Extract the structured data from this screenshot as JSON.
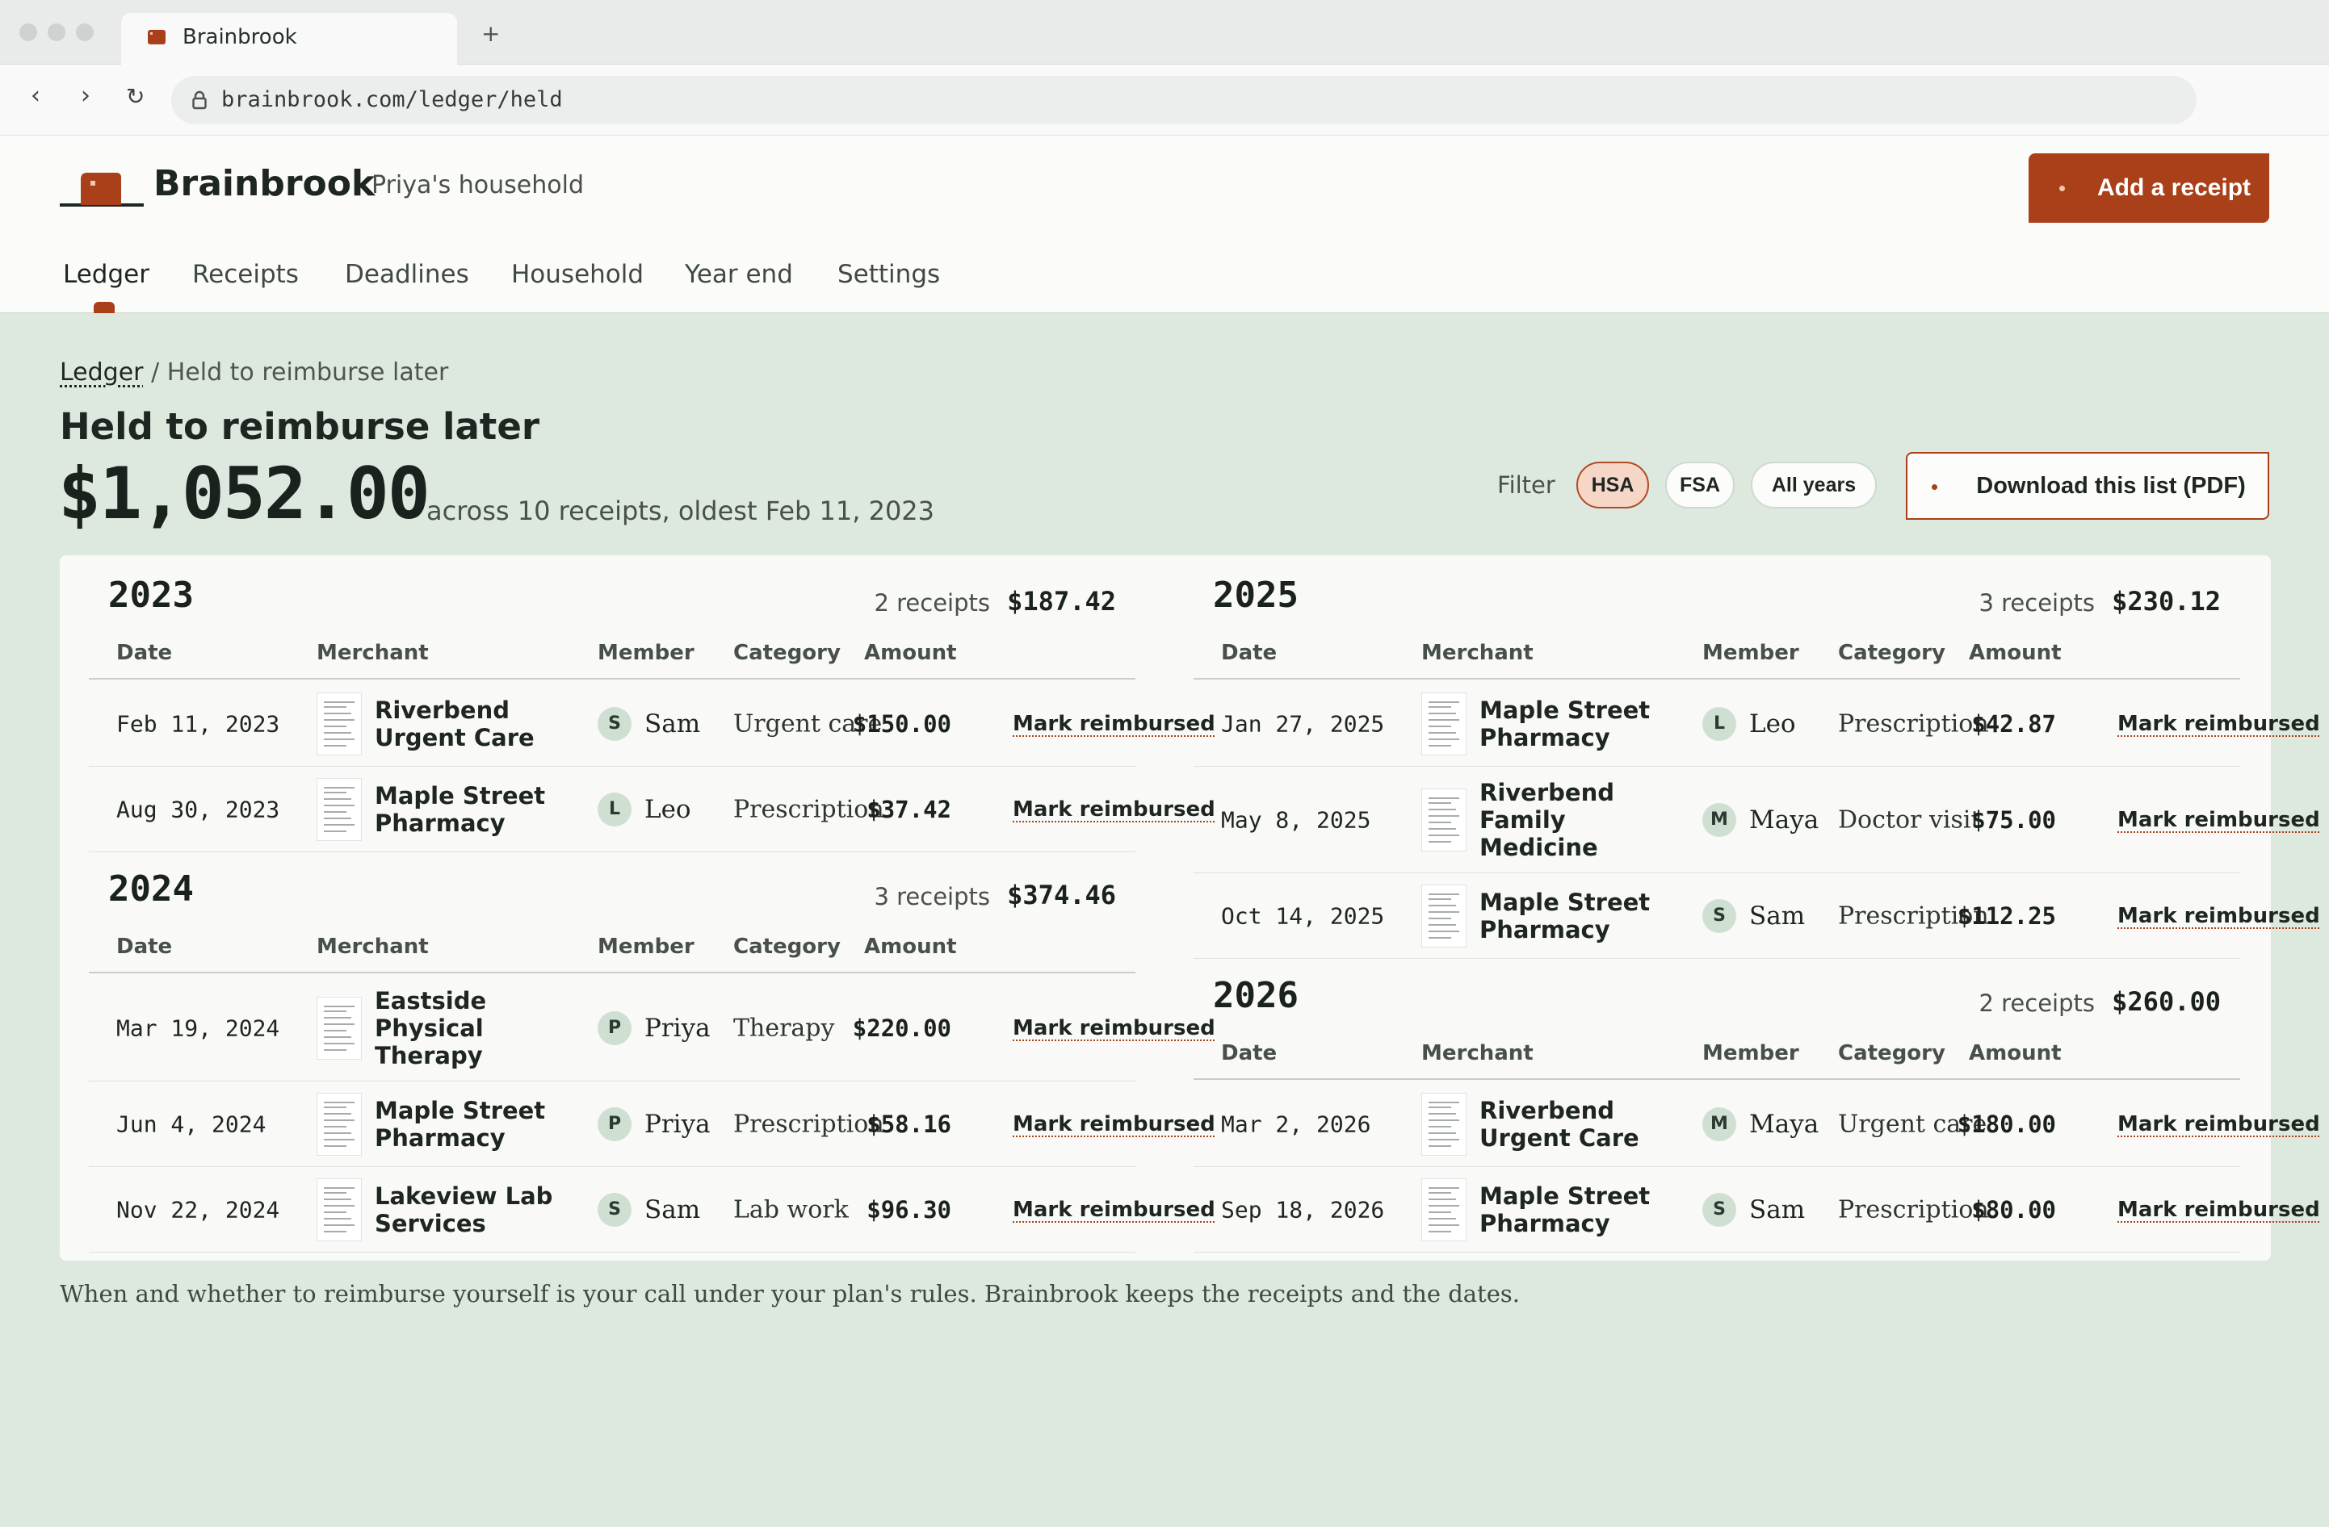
{
  "browser": {
    "tab_title": "Brainbrook",
    "new_tab": "+",
    "url": "brainbrook.com/ledger/held",
    "back": "‹",
    "forward": "›",
    "reload": "↻"
  },
  "app": {
    "brand": "Brainbrook",
    "household": "Priya's household",
    "add_receipt": "Add a receipt",
    "accent": "#a9401a"
  },
  "nav": [
    {
      "label": "Ledger",
      "active": true
    },
    {
      "label": "Receipts"
    },
    {
      "label": "Deadlines"
    },
    {
      "label": "Household"
    },
    {
      "label": "Year end"
    },
    {
      "label": "Settings"
    }
  ],
  "breadcrumb": {
    "root": "Ledger",
    "sep": "/",
    "current": "Held to reimburse later"
  },
  "page": {
    "title": "Held to reimburse later",
    "total": "$1,052.00",
    "total_sub": "across 10 receipts, oldest Feb 11, 2023"
  },
  "filter": {
    "label": "Filter",
    "chips": [
      {
        "label": "HSA",
        "on": true
      },
      {
        "label": "FSA"
      },
      {
        "label": "All years"
      }
    ],
    "download": "Download this list (PDF)"
  },
  "columns": {
    "date": "Date",
    "merchant": "Merchant",
    "member": "Member",
    "category": "Category",
    "amount": "Amount"
  },
  "action_label": "Mark reimbursed",
  "years": [
    {
      "year": "2023",
      "count": "2 receipts",
      "sum": "$187.42",
      "rows": [
        {
          "date": "Feb 11, 2023",
          "merchant": [
            "Riverbend",
            "Urgent Care"
          ],
          "initial": "S",
          "member": "Sam",
          "category": "Urgent care",
          "amount": "$150.00"
        },
        {
          "date": "Aug 30, 2023",
          "merchant": [
            "Maple Street",
            "Pharmacy"
          ],
          "initial": "L",
          "member": "Leo",
          "category": "Prescription",
          "amount": "$37.42"
        }
      ]
    },
    {
      "year": "2024",
      "count": "3 receipts",
      "sum": "$374.46",
      "rows": [
        {
          "date": "Mar 19, 2024",
          "merchant": [
            "Eastside",
            "Physical",
            "Therapy"
          ],
          "initial": "P",
          "member": "Priya",
          "category": "Therapy",
          "amount": "$220.00"
        },
        {
          "date": "Jun 4, 2024",
          "merchant": [
            "Maple Street",
            "Pharmacy"
          ],
          "initial": "P",
          "member": "Priya",
          "category": "Prescription",
          "amount": "$58.16"
        },
        {
          "date": "Nov 22, 2024",
          "merchant": [
            "Lakeview Lab",
            "Services"
          ],
          "initial": "S",
          "member": "Sam",
          "category": "Lab work",
          "amount": "$96.30"
        }
      ]
    },
    {
      "year": "2025",
      "count": "3 receipts",
      "sum": "$230.12",
      "rows": [
        {
          "date": "Jan 27, 2025",
          "merchant": [
            "Maple Street",
            "Pharmacy"
          ],
          "initial": "L",
          "member": "Leo",
          "category": "Prescription",
          "amount": "$42.87"
        },
        {
          "date": "May 8, 2025",
          "merchant": [
            "Riverbend",
            "Family",
            "Medicine"
          ],
          "initial": "M",
          "member": "Maya",
          "category": "Doctor visit",
          "amount": "$75.00"
        },
        {
          "date": "Oct 14, 2025",
          "merchant": [
            "Maple Street",
            "Pharmacy"
          ],
          "initial": "S",
          "member": "Sam",
          "category": "Prescription",
          "amount": "$112.25"
        }
      ]
    },
    {
      "year": "2026",
      "count": "2 receipts",
      "sum": "$260.00",
      "rows": [
        {
          "date": "Mar 2, 2026",
          "merchant": [
            "Riverbend",
            "Urgent Care"
          ],
          "initial": "M",
          "member": "Maya",
          "category": "Urgent care",
          "amount": "$180.00"
        },
        {
          "date": "Sep 18, 2026",
          "merchant": [
            "Maple Street",
            "Pharmacy"
          ],
          "initial": "S",
          "member": "Sam",
          "category": "Prescription",
          "amount": "$80.00"
        }
      ]
    }
  ],
  "footnote": "When and whether to reimburse yourself is your call under your plan's rules. Brainbrook keeps the receipts and the dates."
}
